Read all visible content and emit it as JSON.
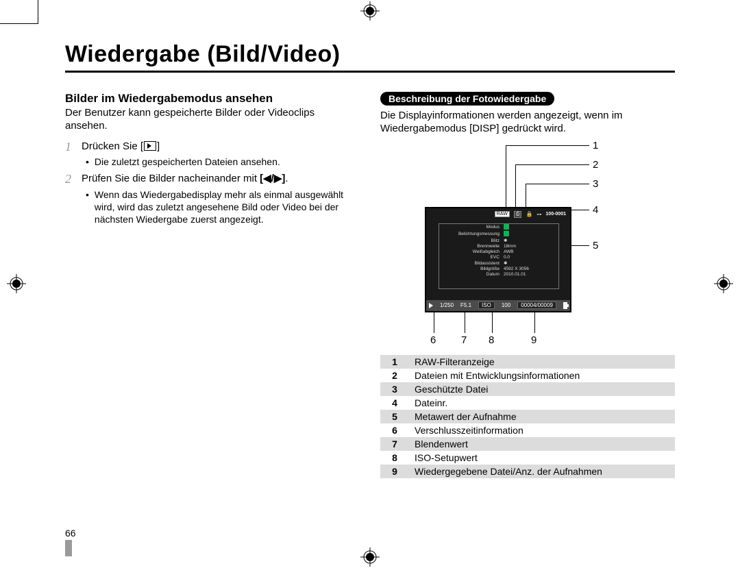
{
  "title": "Wiedergabe (Bild/Video)",
  "page_number": "66",
  "left": {
    "subheading": "Bilder im Wiedergabemodus ansehen",
    "intro": "Der Benutzer kann gespeicherte Bilder oder Videoclips ansehen.",
    "step1_prefix": "Drücken Sie [",
    "step1_suffix": "]",
    "step1_bullet": "Die zuletzt gespeicherten Dateien ansehen.",
    "step2_prefix": "Prüfen Sie die Bilder nacheinander mit ",
    "step2_arrows": "[◀/▶]",
    "step2_suffix": ".",
    "step2_bullet": "Wenn das Wiedergabedisplay mehr als einmal ausgewählt wird, wird das zuletzt angesehene Bild oder Video bei der nächsten Wiedergabe zuerst angezeigt."
  },
  "right": {
    "pill": "Beschreibung der Fotowiedergabe",
    "intro": "Die Displayinformationen werden angezeigt, wenn im Wiedergabemodus [DISP] gedrückt wird.",
    "callouts": {
      "c1": "1",
      "c2": "2",
      "c3": "3",
      "c4": "4",
      "c5": "5",
      "c6": "6",
      "c7": "7",
      "c8": "8",
      "c9": "9"
    },
    "screen": {
      "raw_badge": "RAW",
      "dev_badge": "⎙",
      "lock_icon": "🔒",
      "key_icon": "⊶",
      "file_no": "100-0001",
      "rows": [
        {
          "k": "Modus",
          "v_icon": true
        },
        {
          "k": "Belichtungsmessung",
          "v_icon": true
        },
        {
          "k": "Blitz",
          "v": "✱"
        },
        {
          "k": "Brennweite",
          "v": "18mm"
        },
        {
          "k": "Weißabgleich",
          "v": "AWB"
        },
        {
          "k": "EVC",
          "v": "0.0"
        },
        {
          "k": "Bildassistent",
          "v": "✱"
        },
        {
          "k": "Bildgröße",
          "v": "4592  X  3056"
        },
        {
          "k": "Datum",
          "v": "2010.01.01"
        }
      ],
      "bottom": {
        "shutter": "1/250",
        "aperture": "F5.1",
        "iso_label": "ISO",
        "iso_value": "100",
        "counter": "00004/00009"
      }
    },
    "legend": [
      {
        "n": "1",
        "t": "RAW-Filteranzeige"
      },
      {
        "n": "2",
        "t": "Dateien mit Entwicklungsinformationen"
      },
      {
        "n": "3",
        "t": "Geschützte Datei"
      },
      {
        "n": "4",
        "t": "Dateinr."
      },
      {
        "n": "5",
        "t": "Metawert der Aufnahme"
      },
      {
        "n": "6",
        "t": "Verschlusszeitinformation"
      },
      {
        "n": "7",
        "t": "Blendenwert"
      },
      {
        "n": "8",
        "t": "ISO-Setupwert"
      },
      {
        "n": "9",
        "t": "Wiedergegebene Datei/Anz. der Aufnahmen"
      }
    ]
  }
}
